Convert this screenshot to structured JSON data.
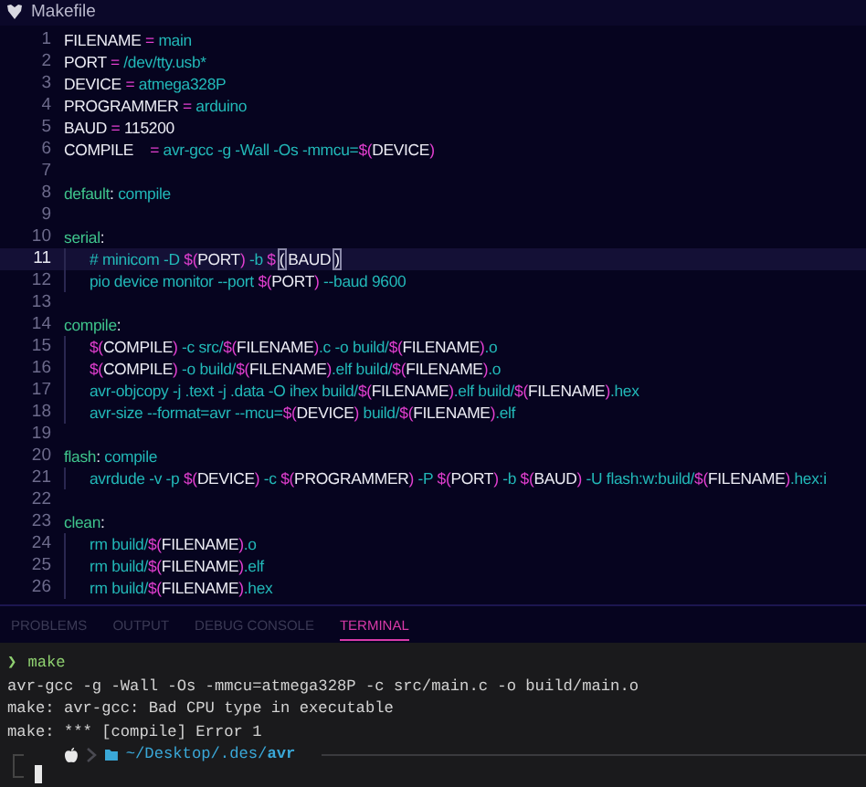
{
  "editor": {
    "tab_title": "Makefile",
    "lines": [
      {
        "number": "1",
        "current": false,
        "indent": false,
        "tokens": [
          {
            "kind": "name",
            "t": "FILENAME"
          },
          {
            "kind": "op",
            "t": " = "
          },
          {
            "kind": "val",
            "t": "main"
          }
        ]
      },
      {
        "number": "2",
        "current": false,
        "indent": false,
        "tokens": [
          {
            "kind": "name",
            "t": "PORT"
          },
          {
            "kind": "op",
            "t": " = "
          },
          {
            "kind": "val",
            "t": "/dev/tty.usb*"
          }
        ]
      },
      {
        "number": "3",
        "current": false,
        "indent": false,
        "tokens": [
          {
            "kind": "name",
            "t": "DEVICE"
          },
          {
            "kind": "op",
            "t": " = "
          },
          {
            "kind": "val",
            "t": "atmega328P"
          }
        ]
      },
      {
        "number": "4",
        "current": false,
        "indent": false,
        "tokens": [
          {
            "kind": "name",
            "t": "PROGRAMMER"
          },
          {
            "kind": "op",
            "t": " = "
          },
          {
            "kind": "val",
            "t": "arduino"
          }
        ]
      },
      {
        "number": "5",
        "current": false,
        "indent": false,
        "tokens": [
          {
            "kind": "name",
            "t": "BAUD"
          },
          {
            "kind": "op",
            "t": " = "
          },
          {
            "kind": "name",
            "t": "115200"
          }
        ]
      },
      {
        "number": "6",
        "current": false,
        "indent": false,
        "tokens": [
          {
            "kind": "name",
            "t": "COMPILE    "
          },
          {
            "kind": "op",
            "t": "= "
          },
          {
            "kind": "val",
            "t": "avr-gcc -g -Wall -Os -mmcu="
          },
          {
            "kind": "op",
            "t": "$("
          },
          {
            "kind": "name",
            "t": "DEVICE"
          },
          {
            "kind": "op",
            "t": ")"
          }
        ]
      },
      {
        "number": "7",
        "current": false,
        "indent": false
      },
      {
        "number": "8",
        "current": false,
        "indent": false,
        "tokens": [
          {
            "kind": "target",
            "t": "default"
          },
          {
            "kind": "name",
            "t": ": "
          },
          {
            "kind": "val",
            "t": "compile"
          }
        ]
      },
      {
        "number": "9",
        "current": false,
        "indent": false
      },
      {
        "number": "10",
        "current": false,
        "indent": false,
        "tokens": [
          {
            "kind": "target",
            "t": "serial"
          },
          {
            "kind": "name",
            "t": ":"
          }
        ]
      },
      {
        "number": "11",
        "current": true,
        "indent": true,
        "tokens": [
          {
            "kind": "val",
            "t": "# minicom -D "
          },
          {
            "kind": "op",
            "t": "$("
          },
          {
            "kind": "name",
            "t": "PORT"
          },
          {
            "kind": "op",
            "t": ")"
          },
          {
            "kind": "val",
            "t": " -b "
          },
          {
            "kind": "op",
            "t": "$"
          },
          {
            "kind": "bracket",
            "t": "("
          },
          {
            "kind": "name",
            "t": "BAUD"
          },
          {
            "kind": "bracket",
            "t": ")"
          }
        ]
      },
      {
        "number": "12",
        "current": false,
        "indent": true,
        "tokens": [
          {
            "kind": "val",
            "t": "pio device monitor --port "
          },
          {
            "kind": "op",
            "t": "$("
          },
          {
            "kind": "name",
            "t": "PORT"
          },
          {
            "kind": "op",
            "t": ")"
          },
          {
            "kind": "val",
            "t": " --baud 9600"
          }
        ]
      },
      {
        "number": "13",
        "current": false,
        "indent": false
      },
      {
        "number": "14",
        "current": false,
        "indent": false,
        "tokens": [
          {
            "kind": "target",
            "t": "compile"
          },
          {
            "kind": "name",
            "t": ":"
          }
        ]
      },
      {
        "number": "15",
        "current": false,
        "indent": true,
        "tokens": [
          {
            "kind": "op",
            "t": "$("
          },
          {
            "kind": "name",
            "t": "COMPILE"
          },
          {
            "kind": "op",
            "t": ")"
          },
          {
            "kind": "val",
            "t": " -c src/"
          },
          {
            "kind": "op",
            "t": "$("
          },
          {
            "kind": "name",
            "t": "FILENAME"
          },
          {
            "kind": "op",
            "t": ")"
          },
          {
            "kind": "val",
            "t": ".c -o build/"
          },
          {
            "kind": "op",
            "t": "$("
          },
          {
            "kind": "name",
            "t": "FILENAME"
          },
          {
            "kind": "op",
            "t": ")"
          },
          {
            "kind": "val",
            "t": ".o"
          }
        ]
      },
      {
        "number": "16",
        "current": false,
        "indent": true,
        "tokens": [
          {
            "kind": "op",
            "t": "$("
          },
          {
            "kind": "name",
            "t": "COMPILE"
          },
          {
            "kind": "op",
            "t": ")"
          },
          {
            "kind": "val",
            "t": " -o build/"
          },
          {
            "kind": "op",
            "t": "$("
          },
          {
            "kind": "name",
            "t": "FILENAME"
          },
          {
            "kind": "op",
            "t": ")"
          },
          {
            "kind": "val",
            "t": ".elf build/"
          },
          {
            "kind": "op",
            "t": "$("
          },
          {
            "kind": "name",
            "t": "FILENAME"
          },
          {
            "kind": "op",
            "t": ")"
          },
          {
            "kind": "val",
            "t": ".o"
          }
        ]
      },
      {
        "number": "17",
        "current": false,
        "indent": true,
        "tokens": [
          {
            "kind": "val",
            "t": "avr-objcopy -j .text -j .data -O ihex build/"
          },
          {
            "kind": "op",
            "t": "$("
          },
          {
            "kind": "name",
            "t": "FILENAME"
          },
          {
            "kind": "op",
            "t": ")"
          },
          {
            "kind": "val",
            "t": ".elf build/"
          },
          {
            "kind": "op",
            "t": "$("
          },
          {
            "kind": "name",
            "t": "FILENAME"
          },
          {
            "kind": "op",
            "t": ")"
          },
          {
            "kind": "val",
            "t": ".hex"
          }
        ]
      },
      {
        "number": "18",
        "current": false,
        "indent": true,
        "tokens": [
          {
            "kind": "val",
            "t": "avr-size --format=avr --mcu="
          },
          {
            "kind": "op",
            "t": "$("
          },
          {
            "kind": "name",
            "t": "DEVICE"
          },
          {
            "kind": "op",
            "t": ")"
          },
          {
            "kind": "val",
            "t": " build/"
          },
          {
            "kind": "op",
            "t": "$("
          },
          {
            "kind": "name",
            "t": "FILENAME"
          },
          {
            "kind": "op",
            "t": ")"
          },
          {
            "kind": "val",
            "t": ".elf"
          }
        ]
      },
      {
        "number": "19",
        "current": false,
        "indent": false
      },
      {
        "number": "20",
        "current": false,
        "indent": false,
        "tokens": [
          {
            "kind": "target",
            "t": "flash"
          },
          {
            "kind": "name",
            "t": ": "
          },
          {
            "kind": "val",
            "t": "compile"
          }
        ]
      },
      {
        "number": "21",
        "current": false,
        "indent": true,
        "tokens": [
          {
            "kind": "val",
            "t": "avrdude -v -p "
          },
          {
            "kind": "op",
            "t": "$("
          },
          {
            "kind": "name",
            "t": "DEVICE"
          },
          {
            "kind": "op",
            "t": ")"
          },
          {
            "kind": "val",
            "t": " -c "
          },
          {
            "kind": "op",
            "t": "$("
          },
          {
            "kind": "name",
            "t": "PROGRAMMER"
          },
          {
            "kind": "op",
            "t": ")"
          },
          {
            "kind": "val",
            "t": " -P "
          },
          {
            "kind": "op",
            "t": "$("
          },
          {
            "kind": "name",
            "t": "PORT"
          },
          {
            "kind": "op",
            "t": ")"
          },
          {
            "kind": "val",
            "t": " -b "
          },
          {
            "kind": "op",
            "t": "$("
          },
          {
            "kind": "name",
            "t": "BAUD"
          },
          {
            "kind": "op",
            "t": ")"
          },
          {
            "kind": "val",
            "t": " -U flash:w:build/"
          },
          {
            "kind": "op",
            "t": "$("
          },
          {
            "kind": "name",
            "t": "FILENAME"
          },
          {
            "kind": "op",
            "t": ")"
          },
          {
            "kind": "val",
            "t": ".hex:i"
          }
        ]
      },
      {
        "number": "22",
        "current": false,
        "indent": false
      },
      {
        "number": "23",
        "current": false,
        "indent": false,
        "tokens": [
          {
            "kind": "target",
            "t": "clean"
          },
          {
            "kind": "name",
            "t": ":"
          }
        ]
      },
      {
        "number": "24",
        "current": false,
        "indent": true,
        "tokens": [
          {
            "kind": "val",
            "t": "rm build/"
          },
          {
            "kind": "op",
            "t": "$("
          },
          {
            "kind": "name",
            "t": "FILENAME"
          },
          {
            "kind": "op",
            "t": ")"
          },
          {
            "kind": "val",
            "t": ".o"
          }
        ]
      },
      {
        "number": "25",
        "current": false,
        "indent": true,
        "tokens": [
          {
            "kind": "val",
            "t": "rm build/"
          },
          {
            "kind": "op",
            "t": "$("
          },
          {
            "kind": "name",
            "t": "FILENAME"
          },
          {
            "kind": "op",
            "t": ")"
          },
          {
            "kind": "val",
            "t": ".elf"
          }
        ]
      },
      {
        "number": "26",
        "current": false,
        "indent": true,
        "tokens": [
          {
            "kind": "val",
            "t": "rm build/"
          },
          {
            "kind": "op",
            "t": "$("
          },
          {
            "kind": "name",
            "t": "FILENAME"
          },
          {
            "kind": "op",
            "t": ")"
          },
          {
            "kind": "val",
            "t": ".hex"
          }
        ]
      }
    ]
  },
  "panel_tabs": [
    {
      "label": "PROBLEMS",
      "selected": false
    },
    {
      "label": "OUTPUT",
      "selected": false
    },
    {
      "label": "DEBUG CONSOLE",
      "selected": false
    },
    {
      "label": "TERMINAL",
      "selected": true
    }
  ],
  "terminal": {
    "lines": [
      {
        "kind": "command",
        "prompt": "❯",
        "text": "make"
      },
      {
        "kind": "output",
        "text": "avr-gcc -g -Wall -Os -mmcu=atmega328P -c src/main.c -o build/main.o"
      },
      {
        "kind": "output",
        "text": "make: avr-gcc: Bad CPU type in executable"
      },
      {
        "kind": "output",
        "text": "make: *** [compile] Error 1"
      }
    ],
    "prompt_path": "~/Desktop/.des/**avr**"
  }
}
